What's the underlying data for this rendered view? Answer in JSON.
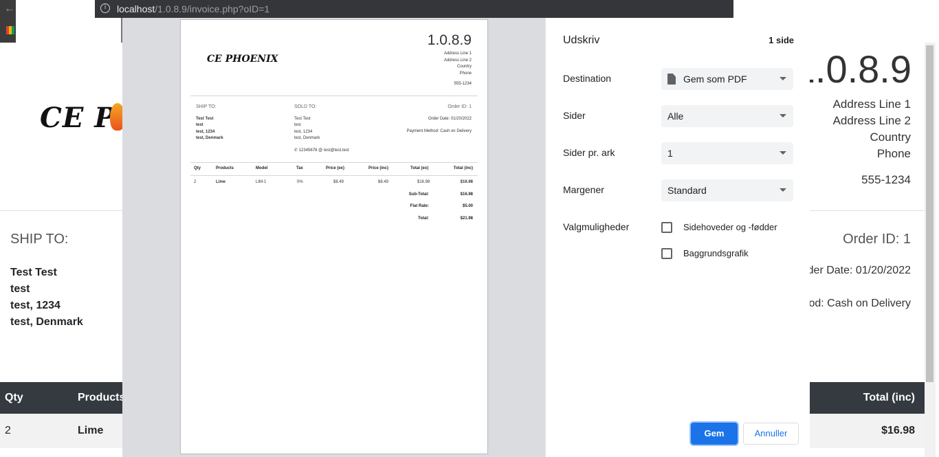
{
  "browser": {
    "url_host": "localhost",
    "url_path": "/1.0.8.9/invoice.php?oID=1"
  },
  "invoice": {
    "logo_text": "CE PHOENIX",
    "version": "1.0.8.9",
    "address_lines": [
      "Address Line 1",
      "Address Line 2",
      "Country",
      "Phone"
    ],
    "phone": "555-1234",
    "ship_to_label": "SHIP TO:",
    "ship_to_lines": [
      "Test Test",
      "test",
      "test, 1234",
      "test, Denmark"
    ],
    "sold_to_label": "SOLD TO:",
    "sold_to_lines": [
      "Test Test",
      "test",
      "test, 1234",
      "test, Denmark"
    ],
    "order_id": "Order ID: 1",
    "order_date": "Order Date: 01/20/2022",
    "payment_method": "Payment Method: Cash on Delivery",
    "contact_phone": "12345678",
    "contact_email": "test@test.test",
    "columns": [
      "Qty",
      "Products",
      "Model",
      "Tax",
      "Price (ex)",
      "Price (inc)",
      "Total (ex)",
      "Total (inc)"
    ],
    "rows": [
      {
        "qty": "2",
        "product": "Lime",
        "model": "LIM-1",
        "tax": "0%",
        "price_ex": "$8.49",
        "price_inc": "$8.49",
        "total_ex": "$16.98",
        "total_inc": "$16.98"
      }
    ],
    "totals": [
      {
        "label": "Sub-Total:",
        "value": "$16.98"
      },
      {
        "label": "Flat Rate:",
        "value": "$5.00"
      },
      {
        "label": "Total:",
        "value": "$21.98"
      }
    ]
  },
  "background_partial": {
    "order_date_partial": "der Date: 01/20/2022",
    "payment_partial": "od: Cash on Delivery",
    "logo_partial": "CE PH"
  },
  "print_dialog": {
    "title": "Udskriv",
    "page_count": "1 side",
    "destination_label": "Destination",
    "destination_value": "Gem som PDF",
    "pages_label": "Sider",
    "pages_value": "Alle",
    "pages_per_sheet_label": "Sider pr. ark",
    "pages_per_sheet_value": "1",
    "margins_label": "Margener",
    "margins_value": "Standard",
    "options_label": "Valgmuligheder",
    "option_headers_footers": "Sidehoveder og -fødder",
    "option_background_graphics": "Baggrundsgrafik",
    "save_button": "Gem",
    "cancel_button": "Annuller",
    "accent_color": "#1a73e8"
  }
}
